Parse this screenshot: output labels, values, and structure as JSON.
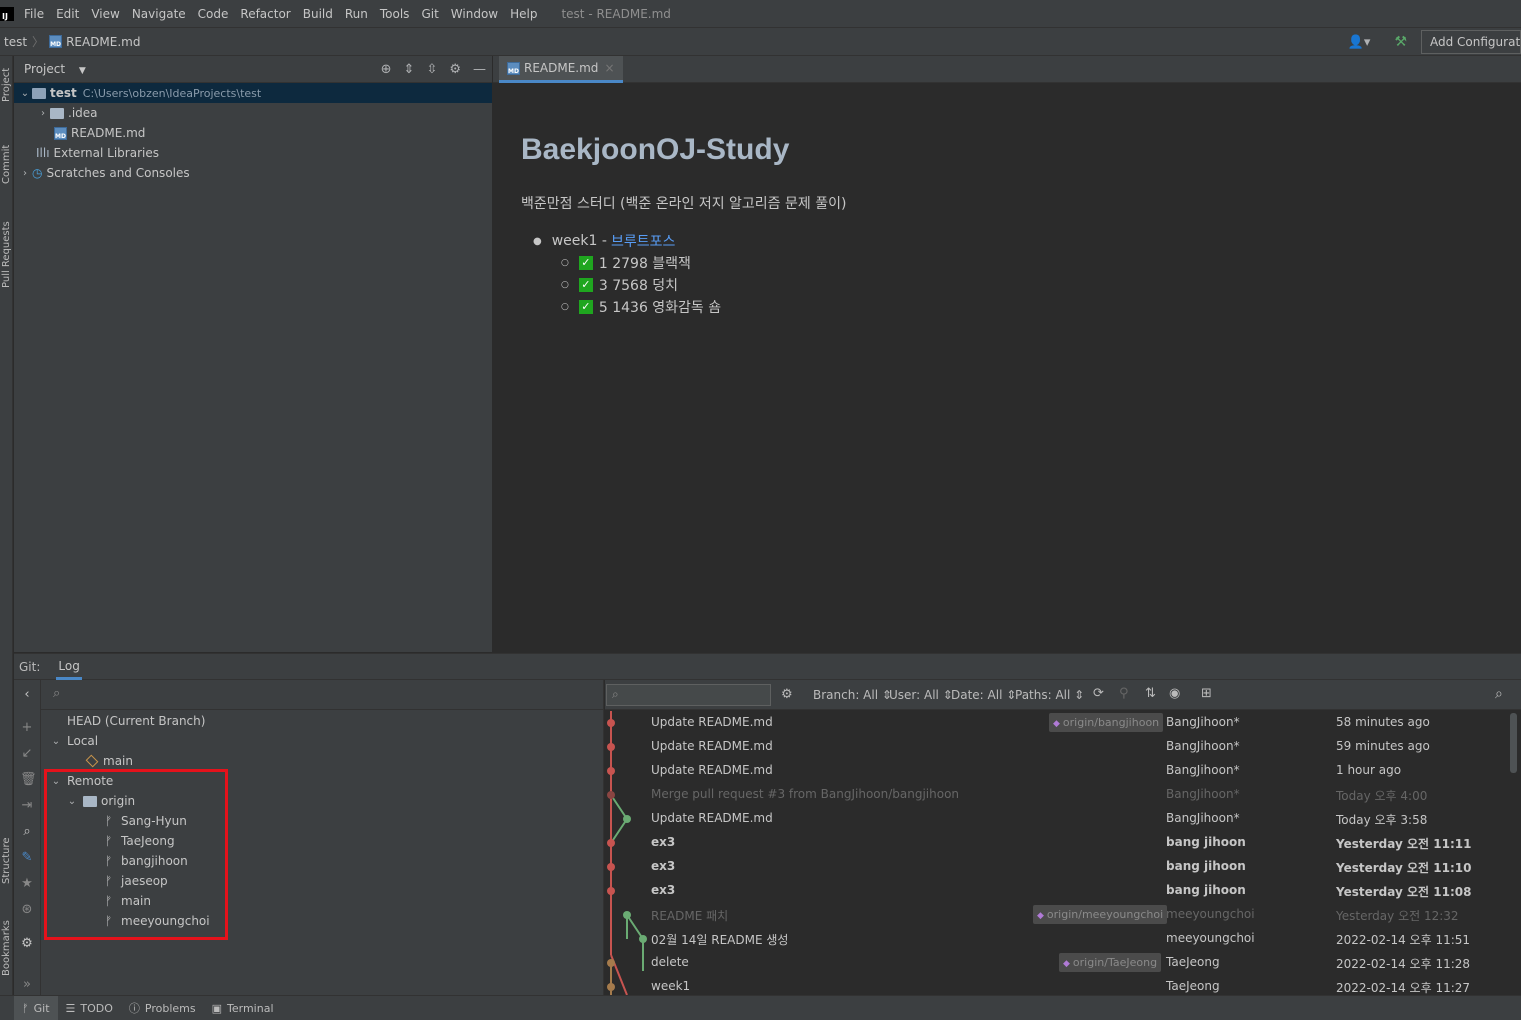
{
  "menu": {
    "items": [
      "File",
      "Edit",
      "View",
      "Navigate",
      "Code",
      "Refactor",
      "Build",
      "Run",
      "Tools",
      "Git",
      "Window",
      "Help"
    ],
    "window_title": "test - README.md",
    "logo": "IJ"
  },
  "navbar": {
    "project": "test",
    "file": "README.md",
    "add_config": "Add Configuration..."
  },
  "left_stripe": {
    "project": "Project",
    "commit": "Commit",
    "pull_requests": "Pull Requests",
    "structure": "Structure",
    "bookmarks": "Bookmarks"
  },
  "project_panel": {
    "title": "Project",
    "tree": {
      "root_name": "test",
      "root_path": "C:\\Users\\obzen\\IdeaProjects\\test",
      "idea": ".idea",
      "readme": "README.md",
      "ext_libs": "External Libraries",
      "scratches": "Scratches and Consoles"
    }
  },
  "editor": {
    "tab": "README.md",
    "heading": "BaekjoonOJ-Study",
    "description": "백준만점 스터디 (백준 온라인 저지 알고리즘 문제 풀이)",
    "week_label": "week1 - ",
    "week_link": "브루트포스",
    "tasks": [
      "1 2798 블랙잭",
      "3 7568 덩치",
      "5 1436 영화감독 숌"
    ]
  },
  "git": {
    "tab_prefix": "Git:",
    "tab_log": "Log",
    "branches": {
      "head": "HEAD (Current Branch)",
      "local": "Local",
      "local_main": "main",
      "remote": "Remote",
      "origin": "origin",
      "remote_branches": [
        "Sang-Hyun",
        "TaeJeong",
        "bangjihoon",
        "jaeseop",
        "main",
        "meeyoungchoi"
      ]
    },
    "filters": {
      "branch": "Branch: All",
      "user": "User: All",
      "date": "Date: All",
      "paths": "Paths: All"
    },
    "log": [
      {
        "msg": "Update README.md",
        "tag": "origin/bangjihoon",
        "author": "BangJihoon*",
        "date": "58 minutes ago"
      },
      {
        "msg": "Update README.md",
        "tag": "",
        "author": "BangJihoon*",
        "date": "59 minutes ago"
      },
      {
        "msg": "Update README.md",
        "tag": "",
        "author": "BangJihoon*",
        "date": "1 hour ago"
      },
      {
        "msg": "Merge pull request #3 from BangJihoon/bangjihoon",
        "tag": "",
        "author": "BangJihoon*",
        "date": "Today 오후 4:00"
      },
      {
        "msg": "Update README.md",
        "tag": "",
        "author": "BangJihoon*",
        "date": "Today 오후 3:58"
      },
      {
        "msg": "ex3",
        "tag": "",
        "author": "bang jihoon",
        "date": "Yesterday 오전 11:11"
      },
      {
        "msg": "ex3",
        "tag": "",
        "author": "bang jihoon",
        "date": "Yesterday 오전 11:10"
      },
      {
        "msg": "ex3",
        "tag": "",
        "author": "bang jihoon",
        "date": "Yesterday 오전 11:08"
      },
      {
        "msg": "README 패치",
        "tag": "origin/meeyoungchoi",
        "author": "meeyoungchoi",
        "date": "Yesterday 오전 12:32"
      },
      {
        "msg": "02월 14일 README 생성",
        "tag": "",
        "author": "meeyoungchoi",
        "date": "2022-02-14 오후 11:51"
      },
      {
        "msg": "delete",
        "tag": "origin/TaeJeong",
        "author": "TaeJeong",
        "date": "2022-02-14 오후 11:28"
      },
      {
        "msg": "week1",
        "tag": "",
        "author": "TaeJeong",
        "date": "2022-02-14 오후 11:27"
      }
    ]
  },
  "bottom_tabs": {
    "git": "Git",
    "todo": "TODO",
    "problems": "Problems",
    "terminal": "Terminal"
  },
  "colors": {
    "accent": "#4a88c7",
    "highlight_box": "#e5121b",
    "graph_red": "#c75450",
    "graph_green": "#6aab73",
    "graph_orange": "#a57b4c"
  }
}
